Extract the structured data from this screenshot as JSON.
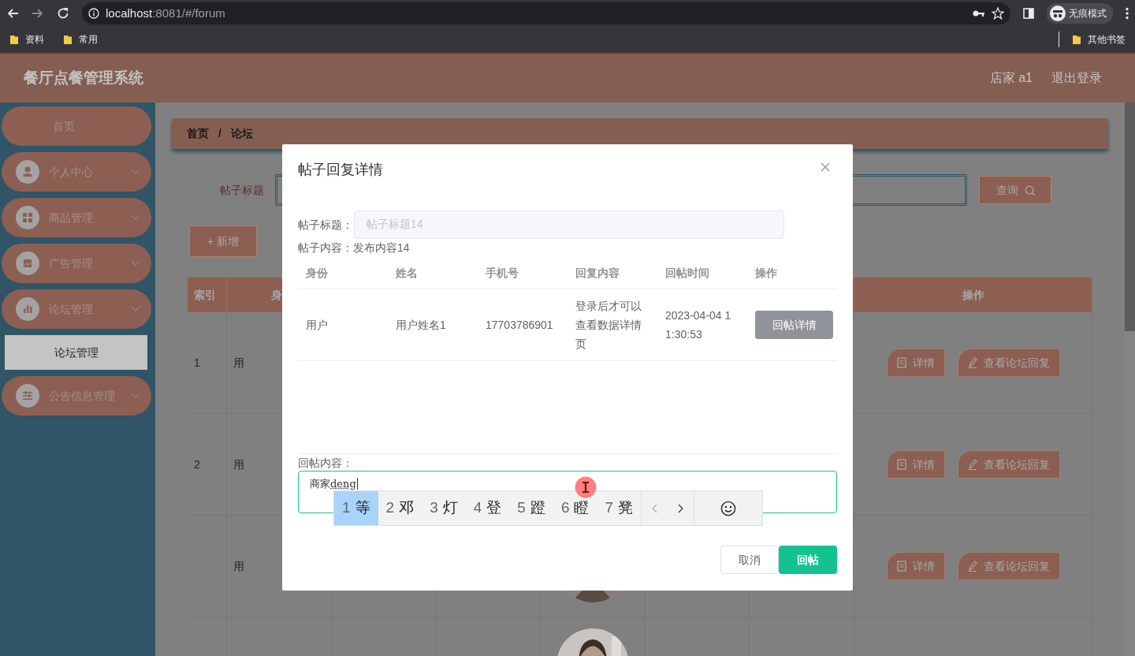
{
  "browser": {
    "url_host": "localhost",
    "url_rest": ":8081/#/forum",
    "profile": "无痕模式",
    "bookmarks": [
      {
        "label": "资料"
      },
      {
        "label": "常用"
      }
    ],
    "other_bookmarks": "其他书签"
  },
  "header": {
    "title": "餐厅点餐管理系统",
    "user": "店家 a1",
    "logout": "退出登录"
  },
  "sidebar": {
    "items": [
      {
        "label": "首页",
        "kind": "plain"
      },
      {
        "label": "个人中心",
        "kind": "group"
      },
      {
        "label": "商品管理",
        "kind": "group"
      },
      {
        "label": "广告管理",
        "kind": "group"
      },
      {
        "label": "论坛管理",
        "kind": "group",
        "children": [
          {
            "label": "论坛管理",
            "selected": true
          }
        ]
      },
      {
        "label": "公告信息管理",
        "kind": "group"
      }
    ]
  },
  "breadcrumb": {
    "items": [
      "首页",
      "论坛"
    ],
    "separator": "/"
  },
  "search": {
    "label": "帖子标题",
    "button": "查询"
  },
  "add_button": "+ 新增",
  "table": {
    "columns": {
      "index": "索引",
      "column_2": "身",
      "actions": "操作"
    },
    "rows": [
      {
        "index": "1",
        "column_2": "用",
        "buttons": [
          "详情",
          "查看论坛回复"
        ]
      },
      {
        "index": "2",
        "column_2": "用",
        "buttons": [
          "详情",
          "查看论坛回复"
        ]
      },
      {
        "column_2": "用",
        "buttons": [
          "详情",
          "查看论坛回复"
        ],
        "photo": {
          "kind": "picture"
        }
      },
      {
        "photo": {
          "kind": "picture"
        }
      }
    ]
  },
  "dialog": {
    "title": "帖子回复详情",
    "post_title_label": "帖子标题：",
    "post_title_value": "帖子标题14",
    "post_content": "帖子内容：发布内容14",
    "columns": [
      "身份",
      "姓名",
      "手机号",
      "回复内容",
      "回帖时间",
      "操作"
    ],
    "rows": [
      {
        "cells": [
          "用户",
          "用户姓名1",
          "17703786901",
          "登录后才可以查看数据详情页",
          "2023-04-04 11:30:53"
        ],
        "button": "回帖详情"
      }
    ],
    "reply_label": "回帖内容：",
    "reply_value": "商家",
    "reply_composing": "deng",
    "cancel": "取消",
    "submit": "回帖"
  },
  "ime": {
    "candidates": [
      {
        "number": "1",
        "text": "等",
        "selected": true
      },
      {
        "number": "2",
        "text": "邓",
        "selected": false
      },
      {
        "number": "3",
        "text": "灯",
        "selected": false
      },
      {
        "number": "4",
        "text": "登",
        "selected": false
      },
      {
        "number": "5",
        "text": "蹬",
        "selected": false
      },
      {
        "number": "6",
        "text": "瞪",
        "selected": false
      },
      {
        "number": "7",
        "text": "凳",
        "selected": false
      }
    ]
  }
}
